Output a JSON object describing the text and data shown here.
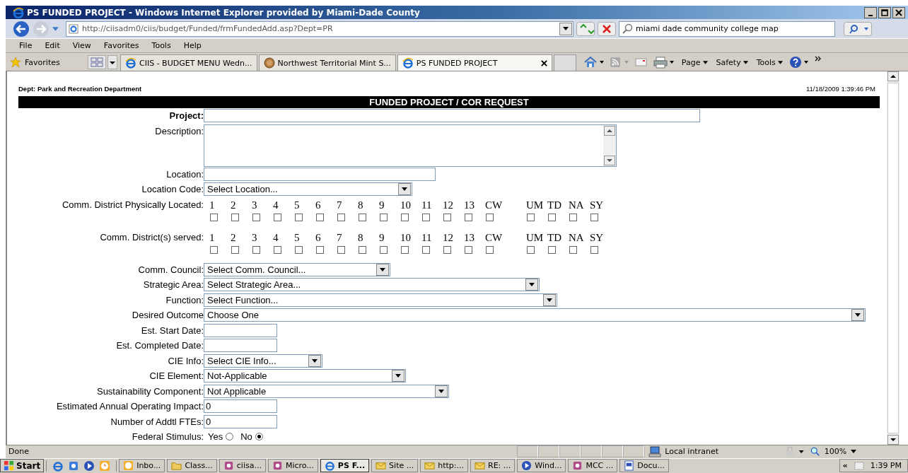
{
  "window": {
    "title": "PS FUNDED PROJECT - Windows Internet Explorer provided by Miami-Dade County"
  },
  "address_bar": {
    "url": "http://ciisadm0/ciis/budget/Funded/frmFundedAdd.asp?Dept=PR",
    "search": "miami dade community college map"
  },
  "menu": [
    "File",
    "Edit",
    "View",
    "Favorites",
    "Tools",
    "Help"
  ],
  "favorites_label": "Favorites",
  "tabs": [
    {
      "label": "CIIS - BUDGET MENU Wedn...",
      "kind": "ie",
      "selected": false
    },
    {
      "label": "Northwest Territorial Mint S...",
      "kind": "coin",
      "selected": false
    },
    {
      "label": "PS FUNDED PROJECT",
      "kind": "ie",
      "selected": true
    }
  ],
  "command_bar": [
    "Page",
    "Safety",
    "Tools"
  ],
  "page": {
    "dept": "Dept: Park and Recreation Department",
    "datetime": "11/18/2009 1:39:46 PM",
    "header": "FUNDED PROJECT / COR REQUEST",
    "fields": [
      {
        "kind": "text",
        "label": "Project:",
        "bold": true
      },
      {
        "kind": "textarea",
        "label": "Description:",
        "bold": false
      },
      {
        "kind": "text",
        "label": "Location:",
        "bold": false
      },
      {
        "kind": "select",
        "label": "Location Code:",
        "value": "Select Location...",
        "bold": false
      },
      {
        "kind": "checkgrid",
        "label": "Comm. District Physically Located:",
        "bold": false,
        "options": [
          {
            "label": "1",
            "checked": false
          },
          {
            "label": "2",
            "checked": false
          },
          {
            "label": "3",
            "checked": false
          },
          {
            "label": "4",
            "checked": false
          },
          {
            "label": "5",
            "checked": false
          },
          {
            "label": "6",
            "checked": false
          },
          {
            "label": "7",
            "checked": false
          },
          {
            "label": "8",
            "checked": false
          },
          {
            "label": "9",
            "checked": false
          },
          {
            "label": "10",
            "checked": false
          },
          {
            "label": "11",
            "checked": false
          },
          {
            "label": "12",
            "checked": false
          },
          {
            "label": "13",
            "checked": false
          },
          {
            "label": "CW",
            "checked": false
          },
          {
            "label": "UM",
            "checked": false
          },
          {
            "label": "TD",
            "checked": false
          },
          {
            "label": "NA",
            "checked": false
          },
          {
            "label": "SY",
            "checked": false
          }
        ]
      },
      {
        "kind": "checkgrid",
        "label": "Comm. District(s) served:",
        "bold": false,
        "options": [
          {
            "label": "1",
            "checked": false
          },
          {
            "label": "2",
            "checked": false
          },
          {
            "label": "3",
            "checked": false
          },
          {
            "label": "4",
            "checked": false
          },
          {
            "label": "5",
            "checked": false
          },
          {
            "label": "6",
            "checked": false
          },
          {
            "label": "7",
            "checked": false
          },
          {
            "label": "8",
            "checked": false
          },
          {
            "label": "9",
            "checked": false
          },
          {
            "label": "10",
            "checked": false
          },
          {
            "label": "11",
            "checked": false
          },
          {
            "label": "12",
            "checked": false
          },
          {
            "label": "13",
            "checked": false
          },
          {
            "label": "CW",
            "checked": false
          },
          {
            "label": "UM",
            "checked": false
          },
          {
            "label": "TD",
            "checked": false
          },
          {
            "label": "NA",
            "checked": false
          },
          {
            "label": "SY",
            "checked": false
          }
        ]
      },
      {
        "kind": "select",
        "label": "Comm. Council:",
        "value": "Select Comm. Council...",
        "bold": false
      },
      {
        "kind": "select",
        "label": "Strategic Area:",
        "value": "Select Strategic Area...",
        "bold": false
      },
      {
        "kind": "select",
        "label": "Function:",
        "value": "Select Function...",
        "bold": false
      },
      {
        "kind": "select",
        "label": "Desired Outcome",
        "value": "Choose One",
        "bold": false
      },
      {
        "kind": "text",
        "label": "Est. Start Date:",
        "bold": false
      },
      {
        "kind": "text",
        "label": "Est. Completed Date:",
        "bold": false
      },
      {
        "kind": "select",
        "label": "CIE Info:",
        "value": "Select CIE Info...",
        "bold": false
      },
      {
        "kind": "select",
        "label": "CIE Element:",
        "value": "Not-Applicable",
        "bold": false
      },
      {
        "kind": "select",
        "label": "Sustainability Component:",
        "value": "Not Applicable",
        "bold": false
      },
      {
        "kind": "text",
        "label": "Estimated Annual Operating Impact:",
        "value": "0",
        "bold": false
      },
      {
        "kind": "text",
        "label": "Number of Addtl FTEs:",
        "value": "0",
        "bold": false
      },
      {
        "kind": "radio",
        "label": "Federal Stimulus:",
        "bold": false,
        "options": [
          {
            "label": "Yes",
            "selected": false
          },
          {
            "label": "No",
            "selected": true
          }
        ]
      }
    ]
  },
  "status_bar": {
    "text": "Done",
    "zone": "Local intranet",
    "zoom": "100%"
  },
  "taskbar": {
    "start": "Start",
    "items": [
      {
        "label": "Inbo...",
        "kind": "clock",
        "selected": false
      },
      {
        "label": "Class...",
        "kind": "folder",
        "selected": false
      },
      {
        "label": "ciisa...",
        "kind": "app",
        "selected": false
      },
      {
        "label": "Micro...",
        "kind": "app",
        "selected": false
      },
      {
        "label": "PS F...",
        "kind": "ie",
        "selected": true
      },
      {
        "label": "Site ...",
        "kind": "mail",
        "selected": false
      },
      {
        "label": "http:...",
        "kind": "mail",
        "selected": false
      },
      {
        "label": "RE: ...",
        "kind": "mail",
        "selected": false
      },
      {
        "label": "Wind...",
        "kind": "play",
        "selected": false
      },
      {
        "label": "MCC ...",
        "kind": "app",
        "selected": false
      },
      {
        "label": "Docu...",
        "kind": "doc",
        "selected": false
      }
    ],
    "tray_toggle": "«",
    "clock": "1:39 PM"
  }
}
